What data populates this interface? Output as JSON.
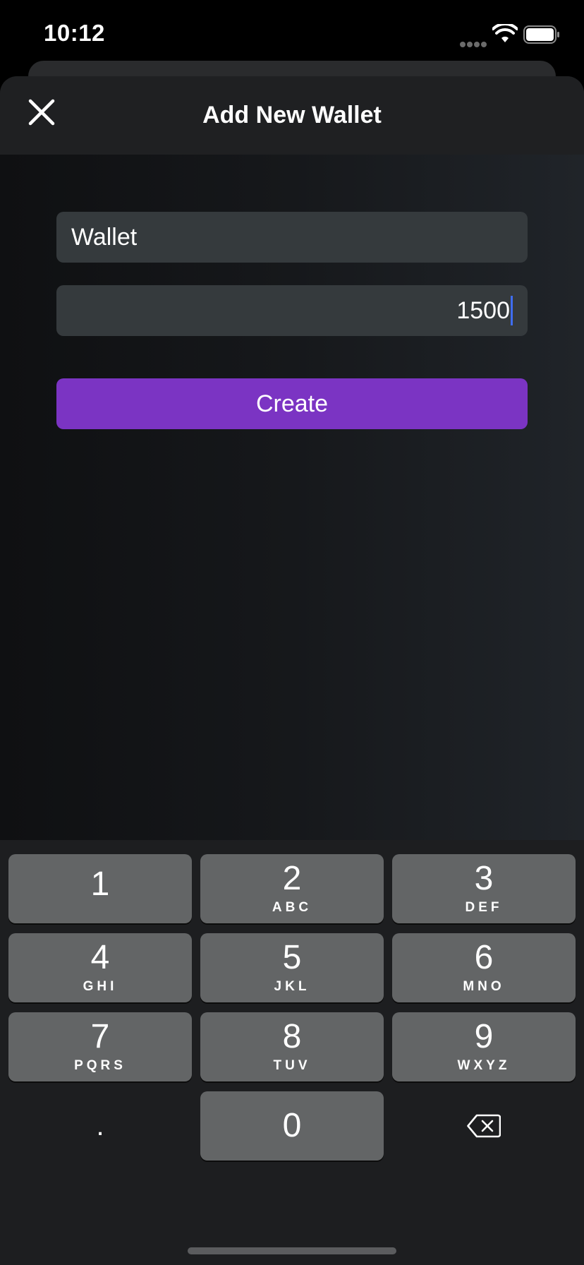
{
  "status_bar": {
    "time": "10:12",
    "icons": [
      "signal-icon",
      "wifi-icon",
      "battery-icon"
    ]
  },
  "nav": {
    "title": "Add New Wallet",
    "close_icon": "close-icon"
  },
  "form": {
    "name_value": "Wallet",
    "amount_value": "1500",
    "create_label": "Create"
  },
  "keypad": {
    "keys": [
      {
        "digit": "1",
        "letters": ""
      },
      {
        "digit": "2",
        "letters": "ABC"
      },
      {
        "digit": "3",
        "letters": "DEF"
      },
      {
        "digit": "4",
        "letters": "GHI"
      },
      {
        "digit": "5",
        "letters": "JKL"
      },
      {
        "digit": "6",
        "letters": "MNO"
      },
      {
        "digit": "7",
        "letters": "PQRS"
      },
      {
        "digit": "8",
        "letters": "TUV"
      },
      {
        "digit": "9",
        "letters": "WXYZ"
      },
      {
        "digit": "0",
        "letters": ""
      }
    ],
    "decimal_label": ".",
    "delete_icon": "backspace-icon"
  },
  "colors": {
    "accent": "#7b34c3",
    "caret": "#3f6df0",
    "key_background": "#636566"
  }
}
